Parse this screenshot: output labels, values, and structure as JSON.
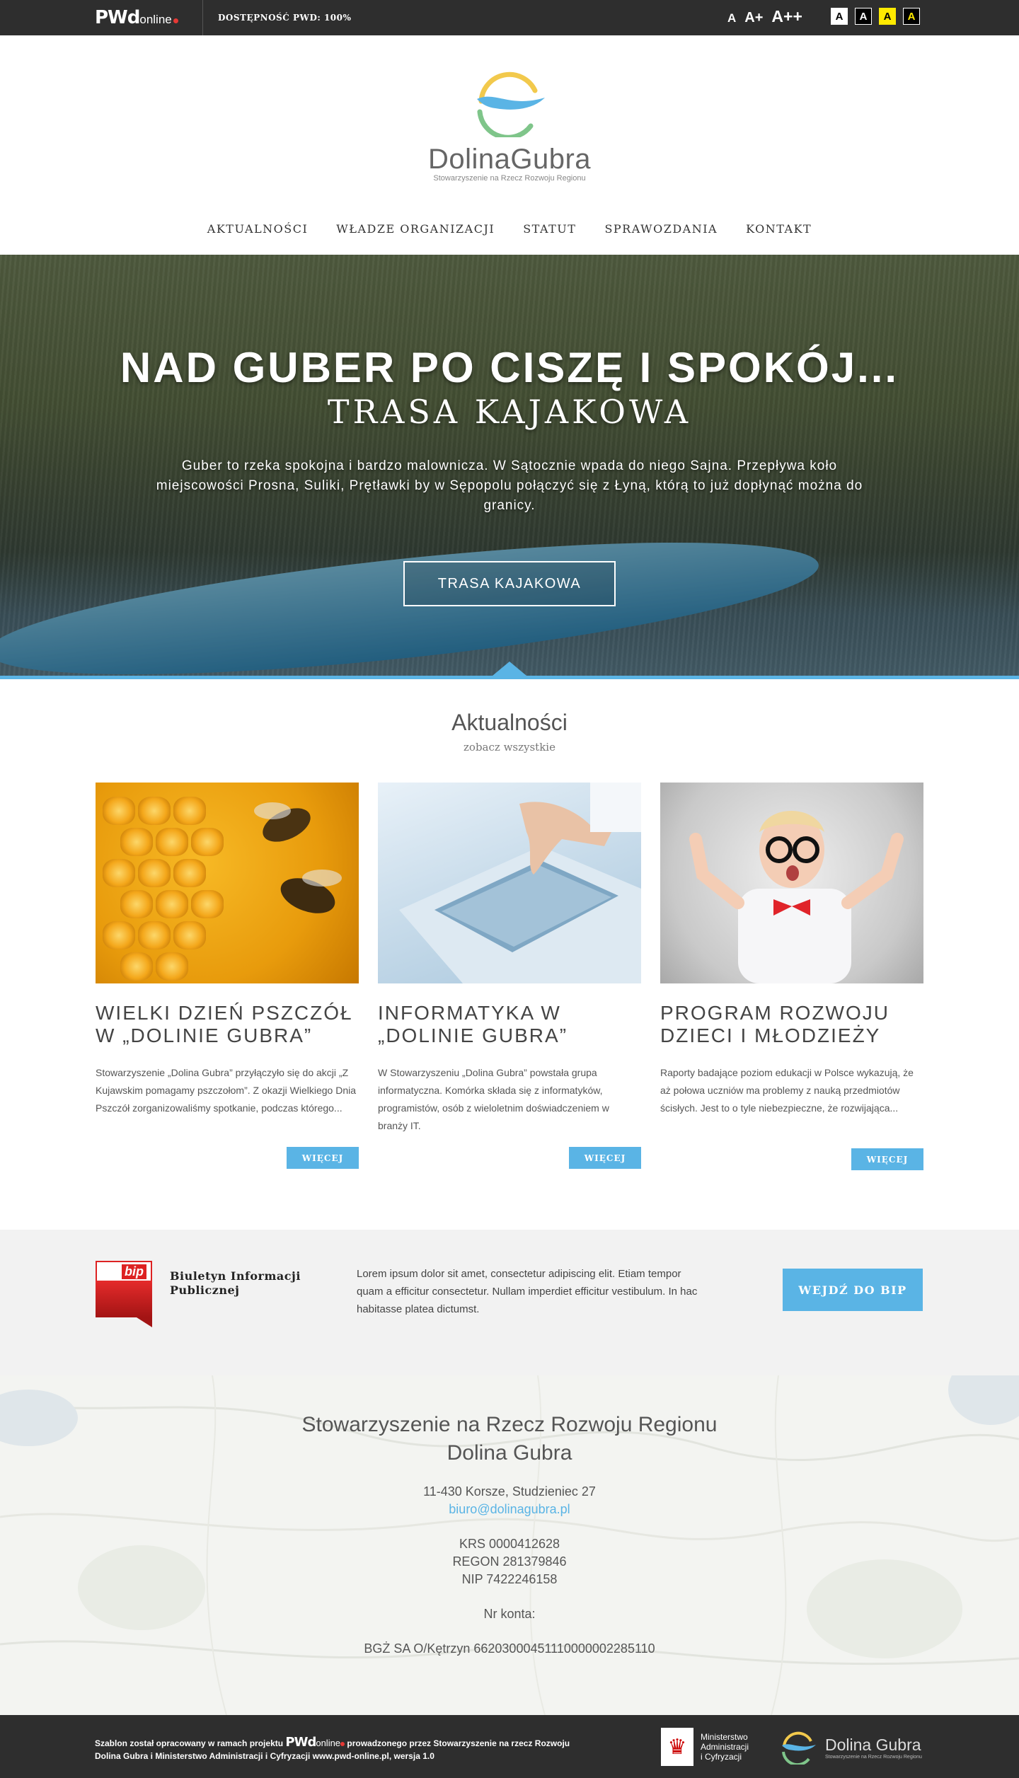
{
  "topbar": {
    "logo_main": "PWd",
    "logo_online": "online",
    "accessibility": "DOSTĘPNOŚĆ PWD: 100%",
    "font_sizes": [
      "A",
      "A+",
      "A++"
    ],
    "contrast": [
      "A",
      "A",
      "A",
      "A"
    ]
  },
  "brand": {
    "name": "DolinaGubra",
    "subtitle": "Stowarzyszenie na Rzecz Rozwoju Regionu"
  },
  "nav": [
    "AKTUALNOŚCI",
    "WŁADZE ORGANIZACJI",
    "STATUT",
    "SPRAWOZDANIA",
    "KONTAKT"
  ],
  "hero": {
    "title": "NAD GUBER PO CISZĘ I SPOKÓJ...",
    "subtitle": "TRASA KAJAKOWA",
    "text": "Guber to rzeka spokojna i bardzo malownicza. W Sątocznie wpada do niego Sajna. Przepływa koło miejscowości Prosna, Suliki, Prętławki by w Sępopolu połączyć się z Łyną, którą to już dopłynąć można do granicy.",
    "button": "TRASA KAJAKOWA"
  },
  "news": {
    "title": "Aktualności",
    "see_all": "zobacz wszystkie",
    "items": [
      {
        "title": "WIELKI DZIEŃ PSZCZÓŁ W „DOLINIE GUBRA”",
        "text": "Stowarzyszenie „Dolina Gubra” przyłączyło się do akcji „Z Kujawskim pomagamy pszczołom”. Z okazji Wielkiego Dnia Pszczół zorganizowaliśmy spotkanie, podczas którego...",
        "more": "WIĘCEJ"
      },
      {
        "title": "INFORMATYKA W „DOLINIE GUBRA”",
        "text": "W Stowarzyszeniu „Dolina Gubra” powstała grupa informatyczna. Komórka składa się z informatyków, programistów, osób z wieloletnim doświadczeniem w branży IT.",
        "more": "WIĘCEJ"
      },
      {
        "title": "PROGRAM ROZWOJU DZIECI I MŁODZIEŻY",
        "text": "Raporty badające poziom edukacji w Polsce wykazują, że aż połowa uczniów ma problemy z nauką przedmiotów ścisłych. Jest to o tyle niebezpieczne, że rozwijająca...",
        "more": "WIĘCEJ"
      }
    ]
  },
  "bip": {
    "logo_text": "bip",
    "title": "Biuletyn Informacji Publicznej",
    "text": "Lorem ipsum dolor sit amet, consectetur adipiscing elit. Etiam tempor quam a efficitur consectetur. Nullam imperdiet efficitur vestibulum. In hac habitasse platea dictumst.",
    "button": "WEJDŹ DO BIP"
  },
  "contact": {
    "org_line1": "Stowarzyszenie na Rzecz Rozwoju Regionu",
    "org_line2": "Dolina Gubra",
    "address": "11-430 Korsze, Studzieniec 27",
    "email": "biuro@dolinagubra.pl",
    "krs": "KRS 0000412628",
    "regon": "REGON 281379846",
    "nip": "NIP 7422246158",
    "account_label": "Nr konta:",
    "account": "BGŻ SA O/Kętrzyn 66203000451110000002285110"
  },
  "footer": {
    "text_before": "Szablon został opracowany w ramach projektu",
    "pwd_main": "PWd",
    "pwd_online": "online",
    "text_after": "prowadzonego przez Stowarzyszenie na rzecz Rozwoju Dolina Gubra i Ministerstwo Administracji i Cyfryzacji www.pwd-online.pl, wersja 1.0",
    "ministry": [
      "Ministerstwo",
      "Administracji",
      "i Cyfryzacji"
    ],
    "brand_name": "Dolina Gubra",
    "brand_sub": "Stowarzyszenie na Rzecz Rozwoju Regionu"
  },
  "colors": {
    "accent": "#5ab4e5",
    "dark": "#2e2e2e",
    "light_bg": "#f2f2f2",
    "bip_red": "#d22222"
  }
}
